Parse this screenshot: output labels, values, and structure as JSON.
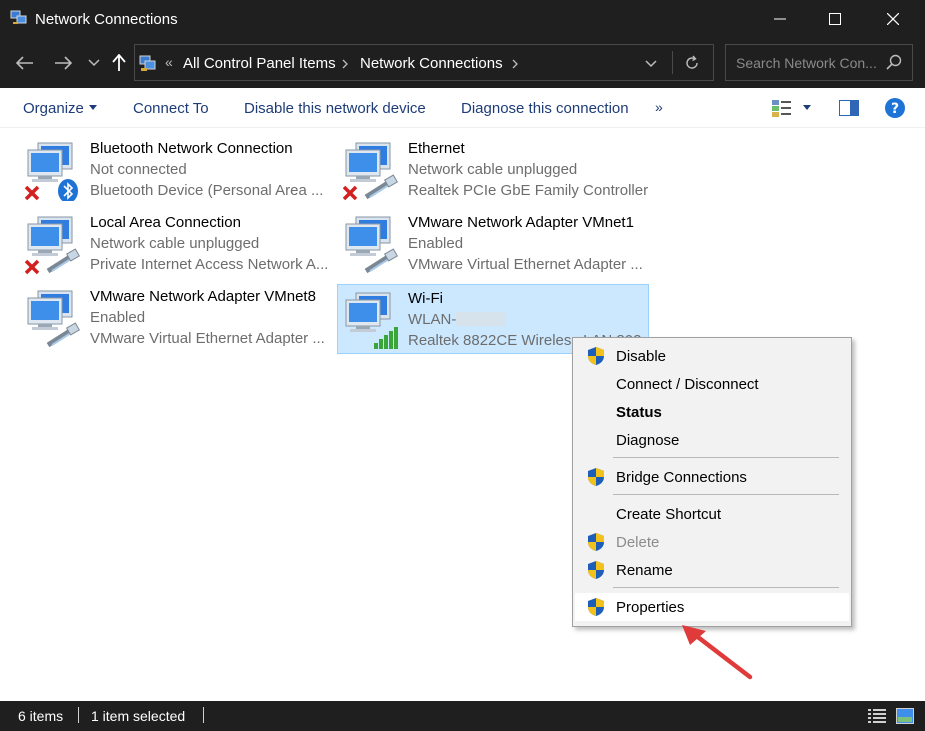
{
  "window": {
    "title": "Network Connections",
    "icons": [
      "network-connections-icon",
      "minimize-icon",
      "maximize-icon",
      "close-icon"
    ]
  },
  "nav": {
    "breadcrumb_overflow": "«",
    "breadcrumbs": [
      "All Control Panel Items",
      "Network Connections"
    ],
    "search_placeholder": "Search Network Con..."
  },
  "toolbar": {
    "organize": "Organize",
    "connect_to": "Connect To",
    "disable": "Disable this network device",
    "diagnose": "Diagnose this connection",
    "more": "»"
  },
  "connections": [
    {
      "name": "Bluetooth Network Connection",
      "status": "Not connected",
      "device": "Bluetooth Device (Personal Area ...",
      "overlay": "x-and-bluetooth"
    },
    {
      "name": "Ethernet",
      "status": "Network cable unplugged",
      "device": "Realtek PCIe GbE Family Controller",
      "overlay": "x-and-cable"
    },
    {
      "name": "Local Area Connection",
      "status": "Network cable unplugged",
      "device": "Private Internet Access Network A...",
      "overlay": "x-and-cable"
    },
    {
      "name": "VMware Network Adapter VMnet1",
      "status": "Enabled",
      "device": "VMware Virtual Ethernet Adapter ...",
      "overlay": "cable"
    },
    {
      "name": "VMware Network Adapter VMnet8",
      "status": "Enabled",
      "device": "VMware Virtual Ethernet Adapter ...",
      "overlay": "cable"
    },
    {
      "name": "Wi-Fi",
      "status": "WLAN-",
      "device": "Realtek 8822CE Wireless LAN 802...",
      "overlay": "signal-bars",
      "selected": true
    }
  ],
  "context_menu": {
    "items": [
      {
        "label": "Disable",
        "shield": true
      },
      {
        "label": "Connect / Disconnect",
        "shield": false
      },
      {
        "label": "Status",
        "shield": false,
        "bold": true
      },
      {
        "label": "Diagnose",
        "shield": false
      },
      {
        "label": "Bridge Connections",
        "shield": true
      },
      {
        "label": "Create Shortcut",
        "shield": false
      },
      {
        "label": "Delete",
        "shield": true,
        "disabled": true
      },
      {
        "label": "Rename",
        "shield": true
      },
      {
        "label": "Properties",
        "shield": true,
        "highlighted": true
      }
    ]
  },
  "status": {
    "item_count": "6 items",
    "selection": "1 item selected"
  },
  "colors": {
    "titlebar_bg": "#1f1f1f",
    "selection_bg": "#cce8ff",
    "selection_border": "#99d1ff",
    "command_text": "#1e3c78",
    "annotation_arrow": "#e03a3a",
    "error_x": "#d21f1f"
  }
}
